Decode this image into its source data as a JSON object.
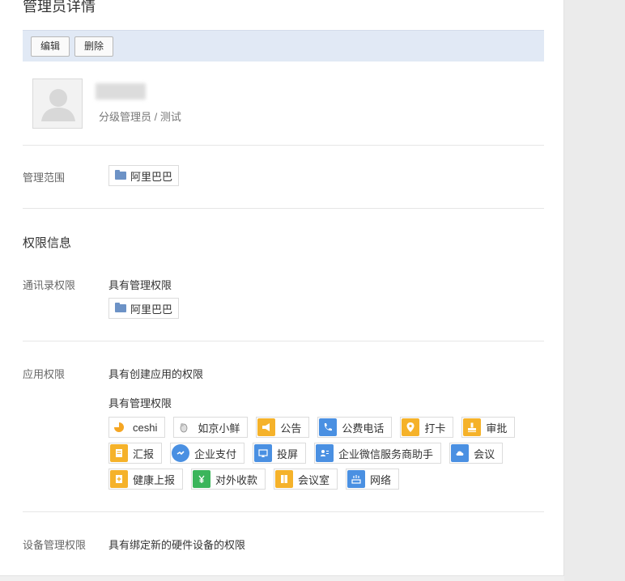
{
  "page": {
    "title": "管理员详情"
  },
  "toolbar": {
    "edit_label": "编辑",
    "delete_label": "删除"
  },
  "profile": {
    "role": "分级管理员 / 测试"
  },
  "scope": {
    "label": "管理范围",
    "dept": "阿里巴巴"
  },
  "permissions": {
    "title": "权限信息",
    "contacts": {
      "label": "通讯录权限",
      "text": "具有管理权限",
      "dept": "阿里巴巴"
    },
    "apps": {
      "label": "应用权限",
      "create_text": "具有创建应用的权限",
      "manage_text": "具有管理权限",
      "items": [
        {
          "name": "ceshi",
          "icon": "pie-chart-icon",
          "color": "#f5a623"
        },
        {
          "name": "如京小鲜",
          "icon": "bird-icon",
          "color": "#ffffff"
        },
        {
          "name": "公告",
          "icon": "megaphone-icon",
          "color": "#f5b22a"
        },
        {
          "name": "公费电话",
          "icon": "phone-icon",
          "color": "#4a90e2"
        },
        {
          "name": "打卡",
          "icon": "location-pin-icon",
          "color": "#f5b22a"
        },
        {
          "name": "审批",
          "icon": "stamp-icon",
          "color": "#f5b22a"
        },
        {
          "name": "汇报",
          "icon": "report-icon",
          "color": "#f5b22a"
        },
        {
          "name": "企业支付",
          "icon": "payment-icon",
          "color": "#4a90e2"
        },
        {
          "name": "投屏",
          "icon": "screen-cast-icon",
          "color": "#4a90e2"
        },
        {
          "name": "企业微信服务商助手",
          "icon": "contact-card-icon",
          "color": "#4a90e2"
        },
        {
          "name": "会议",
          "icon": "cloud-icon",
          "color": "#4a90e2"
        },
        {
          "name": "健康上报",
          "icon": "health-clipboard-icon",
          "color": "#f5b22a"
        },
        {
          "name": "对外收款",
          "icon": "yuan-icon",
          "color": "#3bb55b"
        },
        {
          "name": "会议室",
          "icon": "door-icon",
          "color": "#f5b22a"
        },
        {
          "name": "网络",
          "icon": "wifi-router-icon",
          "color": "#4a90e2"
        }
      ]
    },
    "devices": {
      "label": "设备管理权限",
      "text": "具有绑定新的硬件设备的权限"
    }
  }
}
